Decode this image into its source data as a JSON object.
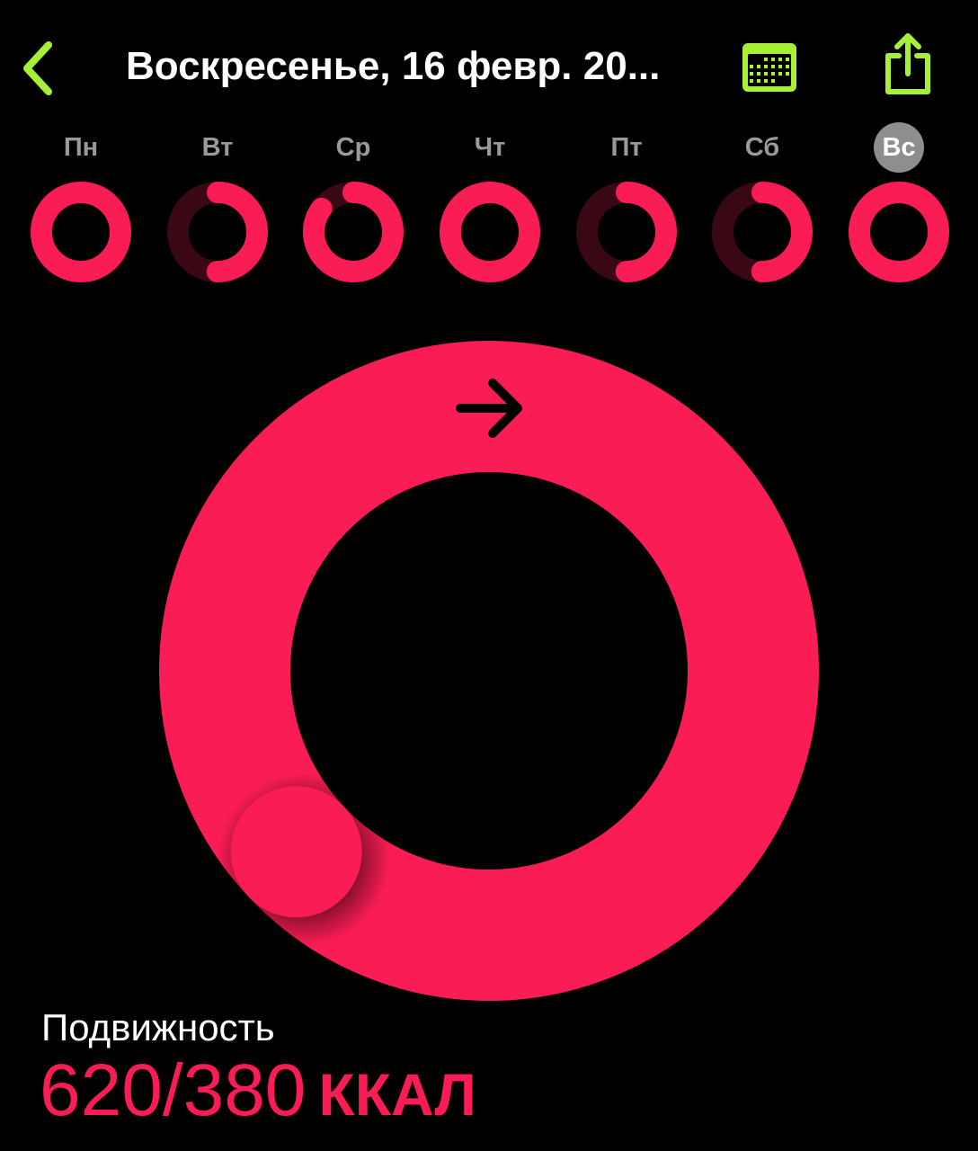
{
  "header": {
    "title": "Воскресенье, 16 февр. 20...",
    "back_icon": "chevron-left-icon",
    "calendar_icon": "calendar-icon",
    "share_icon": "share-icon"
  },
  "week": {
    "days": [
      {
        "label": "Пн",
        "progress": 1.0,
        "selected": false
      },
      {
        "label": "Вт",
        "progress": 0.5,
        "selected": false
      },
      {
        "label": "Ср",
        "progress": 0.85,
        "selected": false
      },
      {
        "label": "Чт",
        "progress": 1.0,
        "selected": false
      },
      {
        "label": "Пт",
        "progress": 0.5,
        "selected": false
      },
      {
        "label": "Сб",
        "progress": 0.5,
        "selected": false
      },
      {
        "label": "Вс",
        "progress": 1.0,
        "selected": true
      }
    ]
  },
  "move": {
    "label": "Подвижность",
    "value": "620/380",
    "unit": "ККАЛ",
    "progress": 1.63,
    "arrow_icon": "arrow-right-icon"
  },
  "colors": {
    "accent": "#a6f037",
    "move": "#fa1c55",
    "move_dim": "#3a0814",
    "background": "#000000",
    "day_label": "#9a9a9a",
    "selected_badge": "#8e8e8e"
  }
}
